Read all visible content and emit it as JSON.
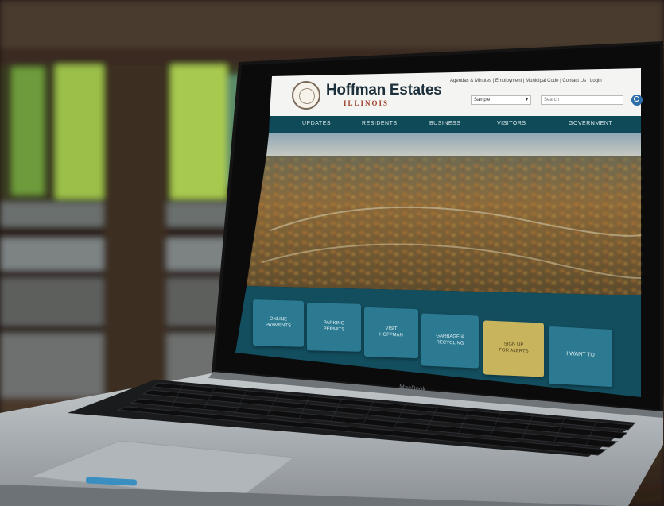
{
  "website": {
    "logo_title": "Hoffman Estates",
    "logo_subtitle": "ILLINOIS",
    "utility_links": "Agendas & Minutes | Employment | Municipal Code | Contact Us | Login",
    "dropdown_value": "Sample",
    "search_placeholder": "Search",
    "nav": [
      {
        "label": "UPDATES"
      },
      {
        "label": "RESIDENTS"
      },
      {
        "label": "BUSINESS"
      },
      {
        "label": "VISITORS"
      },
      {
        "label": "GOVERNMENT"
      }
    ],
    "tiles": [
      {
        "line1": "ONLINE",
        "line2": "PAYMENTS"
      },
      {
        "line1": "PARKING",
        "line2": "PERMITS"
      },
      {
        "line1": "VISIT",
        "line2": "HOFFMAN"
      },
      {
        "line1": "GARBAGE &",
        "line2": "RECYCLING"
      },
      {
        "line1": "SIGN UP",
        "line2": "FOR ALERTS"
      },
      {
        "line1": "I WANT TO",
        "line2": ""
      }
    ]
  },
  "laptop": {
    "brand": "MacBook"
  },
  "colors": {
    "nav_teal": "#0f4a58",
    "tile_blue": "#2b7a92",
    "tile_gold": "#c9b45e",
    "tile_band": "#134e5f",
    "search_button": "#2d6ea8"
  },
  "icons": {
    "search": "magnifier-icon",
    "dropdown": "chevron-down-icon",
    "seal": "municipal-seal-icon"
  }
}
